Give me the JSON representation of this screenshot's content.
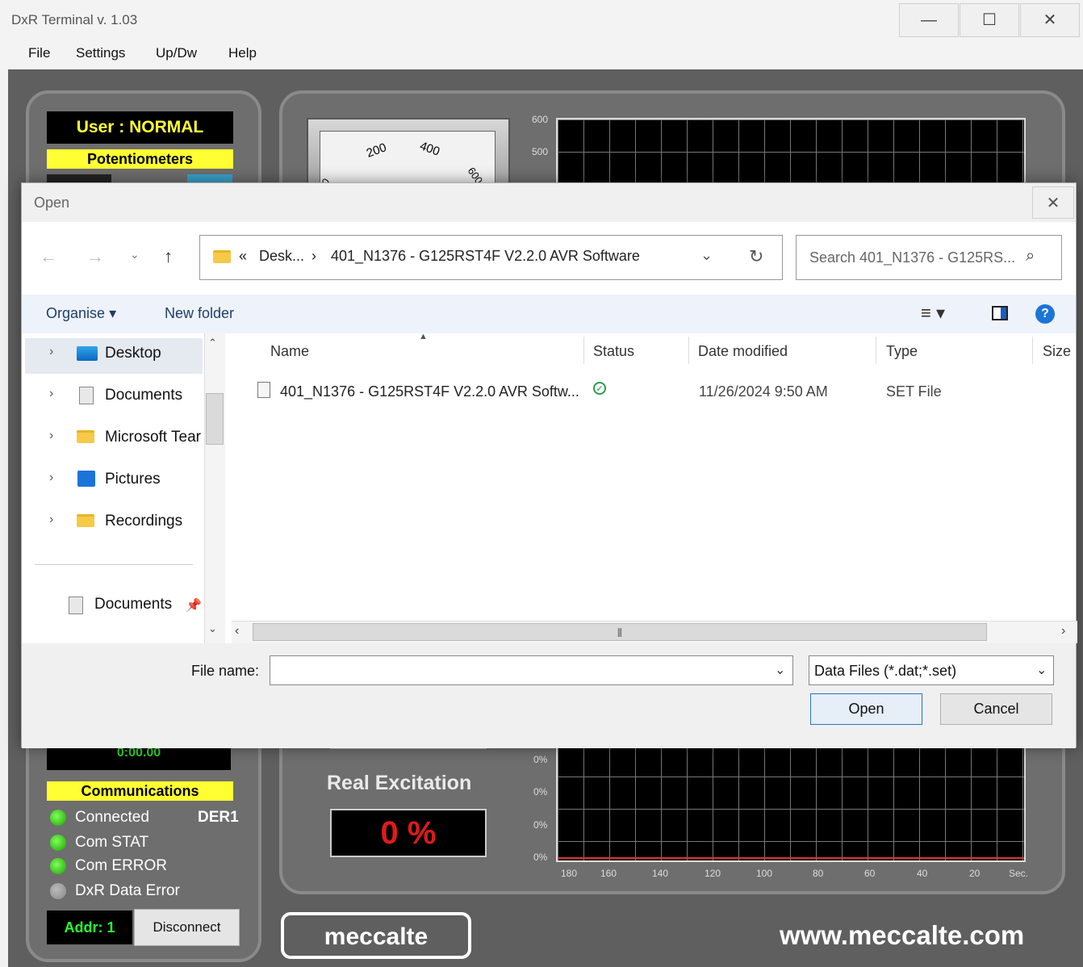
{
  "window": {
    "title": "DxR Terminal v. 1.03",
    "min": "—",
    "max": "☐",
    "close": "✕"
  },
  "menu": [
    "File",
    "Settings",
    "Up/Dw",
    "Help"
  ],
  "app": {
    "user_label": "User : NORMAL",
    "potentiometers_label": "Potentiometers",
    "timer": "0:00.00",
    "communications_label": "Communications",
    "status": [
      {
        "label": "Connected",
        "state": "on"
      },
      {
        "label": "Com STAT",
        "state": "on"
      },
      {
        "label": "Com ERROR",
        "state": "on"
      },
      {
        "label": "DxR Data Error",
        "state": "off"
      }
    ],
    "device": "DER1",
    "addr": "Addr: 1",
    "disconnect": "Disconnect",
    "gauge_ticks": [
      "0",
      "200",
      "400",
      "600"
    ],
    "top_chart_ticks": [
      "600",
      "500"
    ],
    "real_excitation_label": "Real Excitation",
    "real_excitation_value": "0 %",
    "bottom_chart_y": [
      "0%",
      "0%",
      "0%",
      "0%"
    ],
    "bottom_chart_x": [
      "180",
      "160",
      "140",
      "120",
      "100",
      "80",
      "60",
      "40",
      "20",
      "Sec."
    ],
    "logo_text": "meccalte",
    "website": "www.meccalte.com"
  },
  "dialog": {
    "title": "Open",
    "close": "✕",
    "path_prefix": "«",
    "path_part1": "Desk...",
    "path_sep": "›",
    "path_part2": "401_N1376 - G125RST4F V2.2.0 AVR Software",
    "search_placeholder": "Search 401_N1376 - G125RS...",
    "organise": "Organise",
    "new_folder": "New folder",
    "tree": [
      {
        "label": "Desktop",
        "icon": "desktop-icon"
      },
      {
        "label": "Documents",
        "icon": "document-icon"
      },
      {
        "label": "Microsoft Tear",
        "icon": "folder-icon"
      },
      {
        "label": "Pictures",
        "icon": "pictures-icon"
      },
      {
        "label": "Recordings",
        "icon": "folder-icon"
      }
    ],
    "quick_access": "Documents",
    "columns": [
      "Name",
      "Status",
      "Date modified",
      "Type",
      "Size"
    ],
    "files": [
      {
        "name": "401_N1376 - G125RST4F V2.2.0 AVR Softw...",
        "date": "11/26/2024 9:50 AM",
        "type": "SET File"
      }
    ],
    "filename_label": "File name:",
    "filename_value": "",
    "filter": "Data Files (*.dat;*.set)",
    "open_button": "Open",
    "cancel_button": "Cancel"
  }
}
